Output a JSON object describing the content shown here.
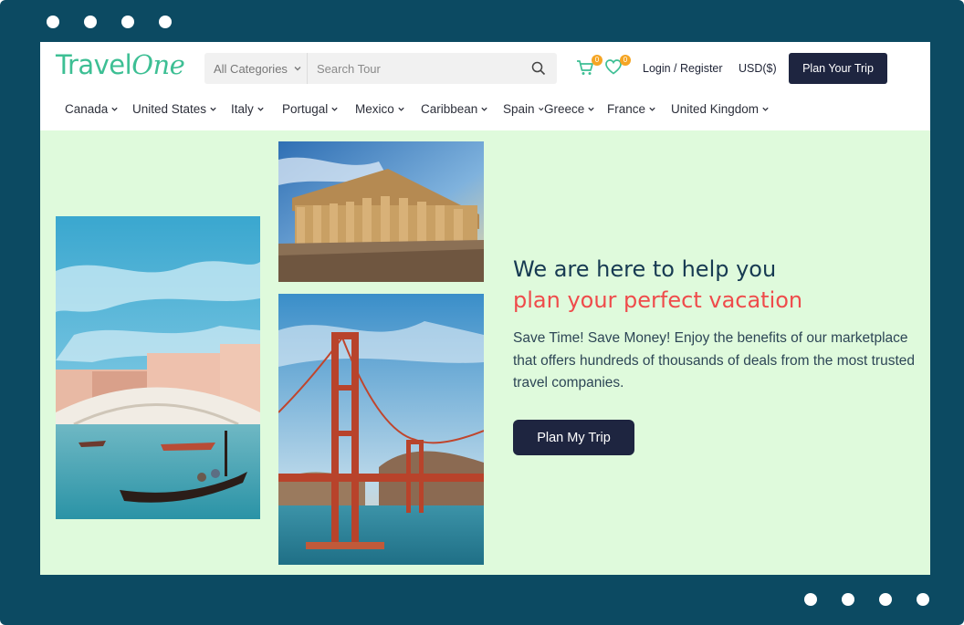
{
  "header": {
    "logo": {
      "part1": "Travel",
      "part2": "One"
    },
    "search": {
      "category": "All Categories",
      "placeholder": "Search Tour"
    },
    "cart_count": "0",
    "wishlist_count": "0",
    "login_label": "Login / Register",
    "currency_label": "USD($)",
    "plan_trip_label": "Plan Your Trip"
  },
  "nav": {
    "items": [
      {
        "label": "Canada"
      },
      {
        "label": "United States"
      },
      {
        "label": "Italy"
      },
      {
        "label": "Portugal"
      },
      {
        "label": "Mexico"
      },
      {
        "label": "Caribbean"
      },
      {
        "label": "Spain"
      },
      {
        "label": "Greece"
      },
      {
        "label": "France"
      },
      {
        "label": "United Kingdom"
      }
    ]
  },
  "hero": {
    "headline_line1": "We are here to help you",
    "headline_line2": "plan your perfect vacation",
    "description": "Save Time! Save Money! Enjoy the benefits of our marketplace that offers hundreds of thousands of deals from the most trusted travel companies.",
    "cta_label": "Plan My Trip"
  },
  "colors": {
    "frame": "#0c4a62",
    "brand": "#3dbf94",
    "accent_red": "#ef4b4b",
    "heading": "#173a52",
    "button": "#1e2540",
    "hero_bg": "#dffadc",
    "badge": "#f5a524"
  },
  "icons": {
    "search": "search-icon",
    "cart": "cart-icon",
    "wishlist": "heart-icon",
    "dropdown": "chevron-down-icon"
  }
}
